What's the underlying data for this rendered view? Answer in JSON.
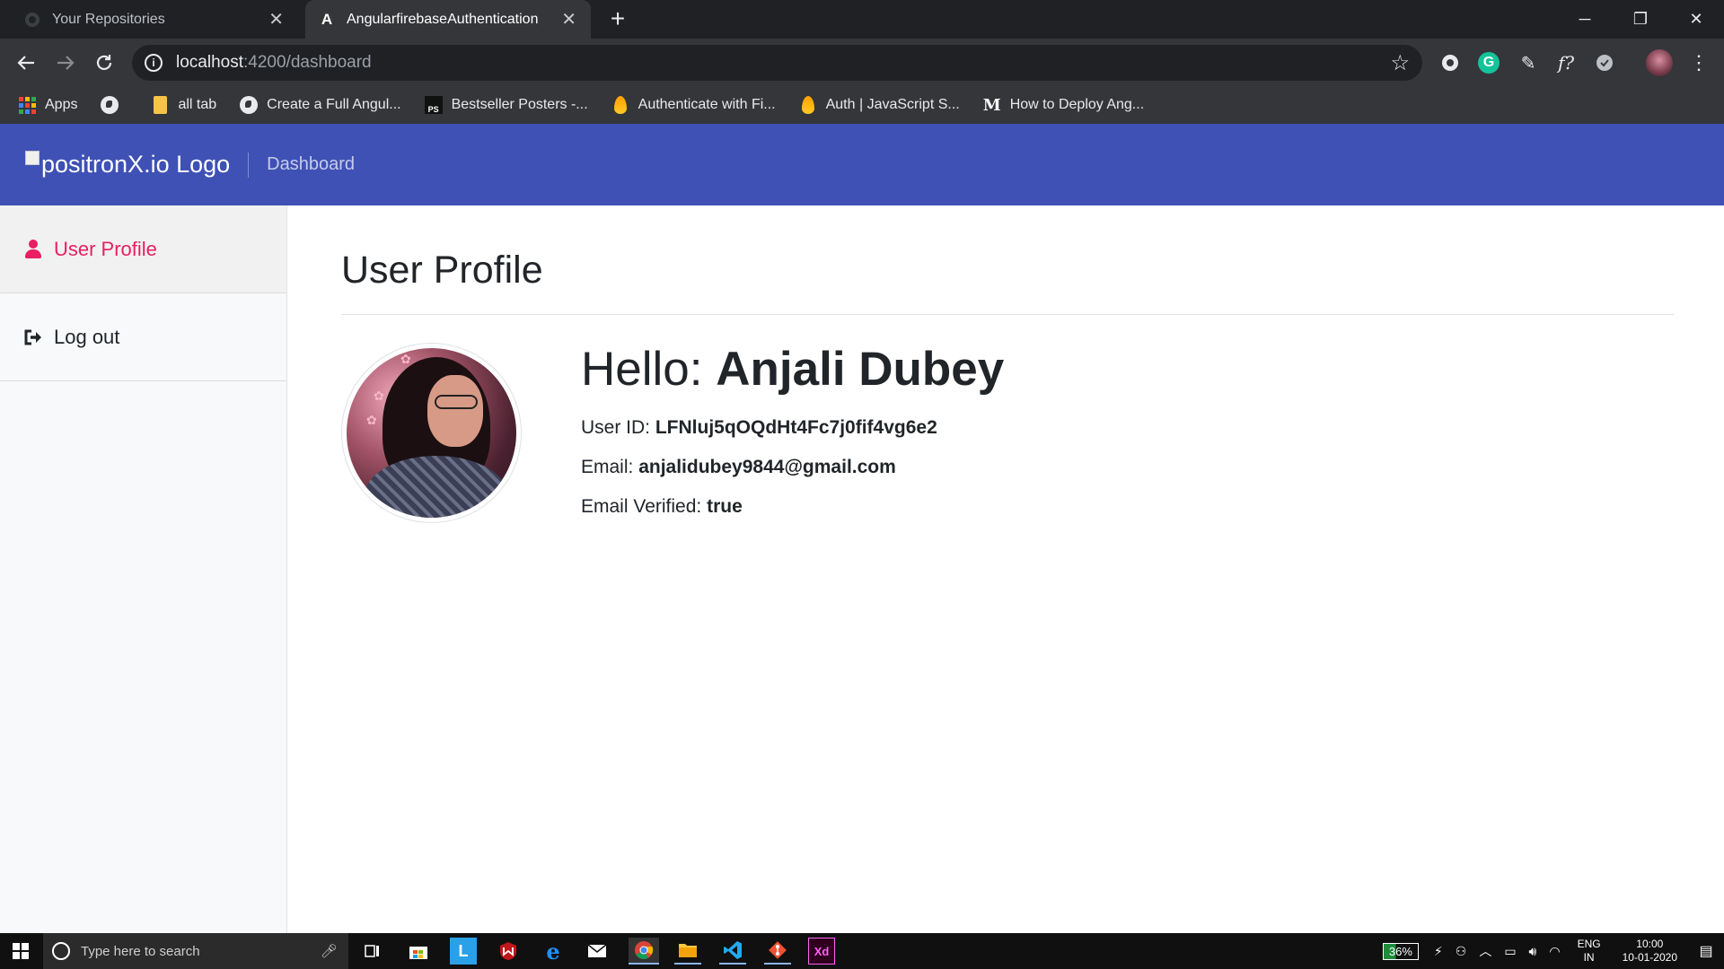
{
  "browser": {
    "tabs": [
      {
        "title": "Your Repositories",
        "icon": "github-icon"
      },
      {
        "title": "AngularfirebaseAuthentication",
        "icon": "angular-icon"
      }
    ],
    "new_tab": "+",
    "window_controls": {
      "minimize": "─",
      "restore": "❐",
      "close": "✕"
    },
    "url_host": "localhost",
    "url_rest": ":4200/dashboard",
    "bookmarks": [
      {
        "label": "Apps",
        "icon": "apps-grid-icon"
      },
      {
        "label": "",
        "icon": "globe-icon"
      },
      {
        "label": "all tab",
        "icon": "folder-icon"
      },
      {
        "label": "Create a Full Angul...",
        "icon": "globe-icon"
      },
      {
        "label": "Bestseller Posters -...",
        "icon": "ps-icon"
      },
      {
        "label": "Authenticate with Fi...",
        "icon": "firebase-icon"
      },
      {
        "label": "Auth | JavaScript S...",
        "icon": "firebase-icon"
      },
      {
        "label": "How to Deploy Ang...",
        "icon": "medium-icon"
      }
    ]
  },
  "app": {
    "logo_alt": "positronX.io Logo",
    "nav_link": "Dashboard",
    "sidebar": [
      {
        "label": "User Profile",
        "active": true,
        "icon": "user-icon"
      },
      {
        "label": "Log out",
        "active": false,
        "icon": "sign-out-icon"
      }
    ],
    "page_title": "User Profile",
    "hello_prefix": "Hello:",
    "user_name": "Anjali Dubey",
    "user_id_label": "User ID:",
    "user_id": "LFNluj5qOQdHt4Fc7j0fif4vg6e2",
    "email_label": "Email:",
    "email": "anjalidubey9844@gmail.com",
    "verified_label": "Email Verified:",
    "verified": "true"
  },
  "taskbar": {
    "search_placeholder": "Type here to search",
    "battery": "36%",
    "lang_top": "ENG",
    "lang_bottom": "IN",
    "time": "10:00",
    "date": "10-01-2020"
  },
  "colors": {
    "navbar": "#3f51b5",
    "accent": "#e91e63"
  }
}
